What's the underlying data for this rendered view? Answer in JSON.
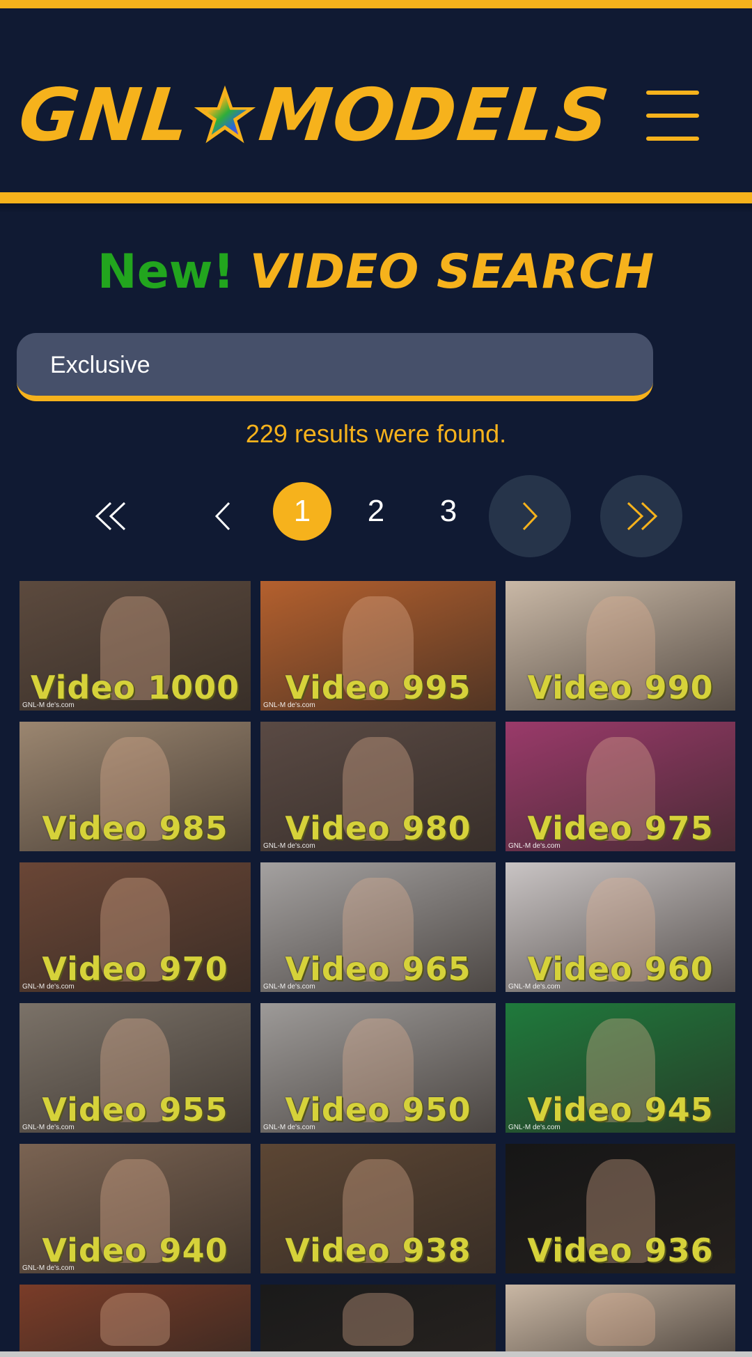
{
  "header": {
    "logo_left": "GNL",
    "logo_right": "MODELS",
    "menu_icon": "hamburger-menu-icon"
  },
  "search": {
    "title_new": "New!",
    "title_main": "VIDEO SEARCH",
    "value": "Exclusive",
    "results_text": "229 results were found."
  },
  "pagination": {
    "first": "first-page-icon",
    "prev": "prev-page-icon",
    "pages": [
      "1",
      "2",
      "3"
    ],
    "active_page": "1",
    "next": "next-page-icon",
    "last": "last-page-icon"
  },
  "videos": [
    {
      "caption": "Video 1000",
      "watermark": "GNL-M de's.com",
      "bg": "#5c4a3e"
    },
    {
      "caption": "Video 995",
      "watermark": "GNL-M de's.com",
      "bg": "#b4602e"
    },
    {
      "caption": "Video 990",
      "watermark": "",
      "bg": "#c9b8a6"
    },
    {
      "caption": "Video 985",
      "watermark": "",
      "bg": "#9b8670"
    },
    {
      "caption": "Video 980",
      "watermark": "GNL-M de's.com",
      "bg": "#5a4a44"
    },
    {
      "caption": "Video 975",
      "watermark": "GNL-M de's.com",
      "bg": "#9a3a6a"
    },
    {
      "caption": "Video 970",
      "watermark": "GNL-M de's.com",
      "bg": "#6a4636"
    },
    {
      "caption": "Video 965",
      "watermark": "GNL-M de's.com",
      "bg": "#a4a1a0"
    },
    {
      "caption": "Video 960",
      "watermark": "GNL-M de's.com",
      "bg": "#c9c4c4"
    },
    {
      "caption": "Video 955",
      "watermark": "GNL-M de's.com",
      "bg": "#7b7268"
    },
    {
      "caption": "Video 950",
      "watermark": "GNL-M de's.com",
      "bg": "#9d9a98"
    },
    {
      "caption": "Video 945",
      "watermark": "GNL-M de's.com",
      "bg": "#1f7a3c"
    },
    {
      "caption": "Video 940",
      "watermark": "GNL-M de's.com",
      "bg": "#7a6352"
    },
    {
      "caption": "Video 938",
      "watermark": "",
      "bg": "#5c4634"
    },
    {
      "caption": "Video 936",
      "watermark": "",
      "bg": "#161616"
    },
    {
      "caption": "",
      "watermark": "",
      "bg": "#7a3c28"
    },
    {
      "caption": "",
      "watermark": "",
      "bg": "#1a1a1a"
    },
    {
      "caption": "",
      "watermark": "",
      "bg": "#c9b7a4"
    }
  ],
  "colors": {
    "background": "#101a33",
    "accent": "#f6b21c",
    "new_green": "#22a51e",
    "search_bg": "#46506a",
    "pager_circle": "#26344a"
  }
}
